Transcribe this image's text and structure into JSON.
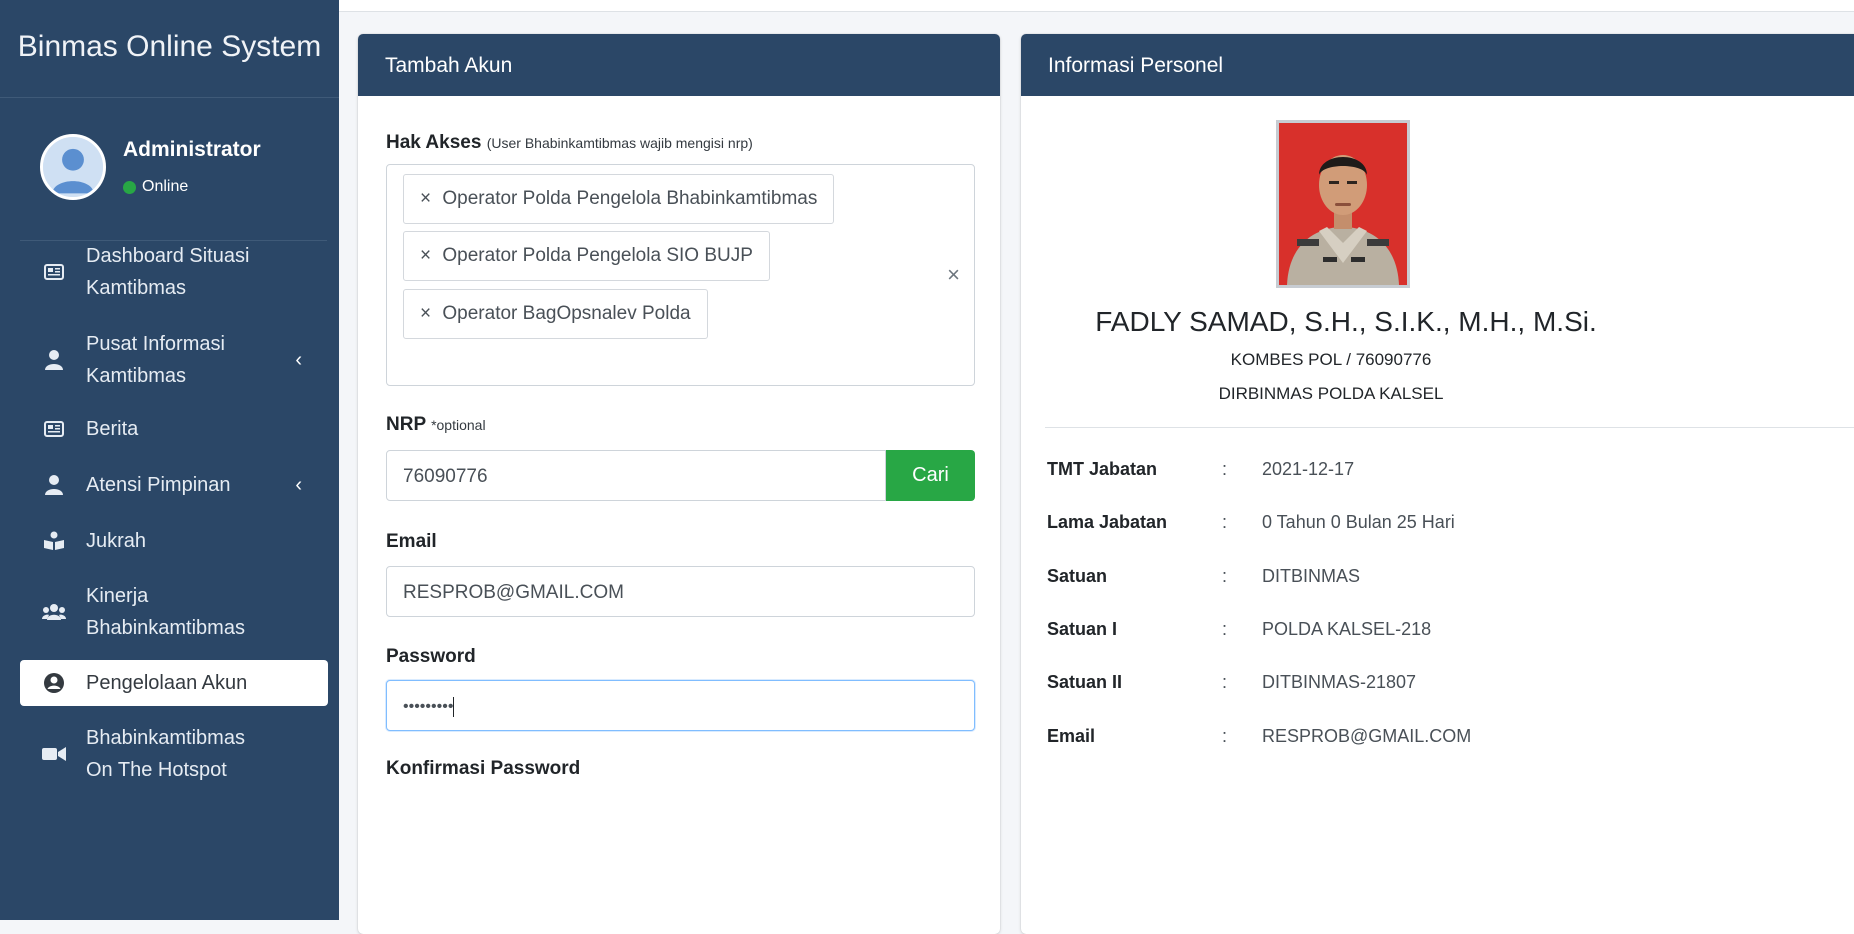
{
  "sidebar": {
    "brand": "Binmas Online System",
    "user": {
      "name": "Administrator",
      "status": "Online"
    },
    "items": [
      {
        "label_line1": "Dashboard Situasi",
        "label_line2": "Kamtibmas",
        "icon": "newspaper-icon"
      },
      {
        "label_line1": "Pusat Informasi",
        "label_line2": "Kamtibmas",
        "icon": "user-group-icon"
      },
      {
        "label": "Berita",
        "icon": "newspaper-icon"
      },
      {
        "label": "Atensi Pimpinan",
        "icon": "user-group-icon"
      },
      {
        "label": "Jukrah",
        "icon": "reader-icon"
      },
      {
        "label_line1": "Kinerja",
        "label_line2": "Bhabinkamtibmas",
        "icon": "users-icon"
      },
      {
        "label": "Pengelolaan Akun",
        "icon": "user-circle-icon"
      },
      {
        "label_line1": "Bhabinkamtibmas",
        "label_line2": "On The Hotspot",
        "icon": "video-icon"
      }
    ]
  },
  "form": {
    "title": "Tambah Akun",
    "hak_akses_label": "Hak Akses",
    "hak_akses_hint": "(User Bhabinkamtibmas wajib mengisi nrp)",
    "tags": [
      "Operator Polda Pengelola Bhabinkamtibmas",
      "Operator Polda Pengelola SIO BUJP",
      "Operator BagOpsnalev Polda"
    ],
    "tag_remove_glyph": "×",
    "clear_glyph": "×",
    "nrp_label": "NRP",
    "nrp_hint": "*optional",
    "nrp_value": "76090776",
    "cari_label": "Cari",
    "email_label": "Email",
    "email_value": "RESPROB@GMAIL.COM",
    "password_label": "Password",
    "password_value": "•••••••••",
    "konfirmasi_label": "Konfirmasi Password"
  },
  "personel": {
    "title": "Informasi Personel",
    "name": "FADLY SAMAD, S.H., S.I.K., M.H., M.Si.",
    "rank_nrp": "KOMBES POL / 76090776",
    "unit": "DIRBINMAS POLDA KALSEL",
    "separator": ":",
    "rows": [
      {
        "key": "TMT Jabatan",
        "value": "2021-12-17"
      },
      {
        "key": "Lama Jabatan",
        "value": "0 Tahun 0 Bulan 25 Hari"
      },
      {
        "key": "Satuan",
        "value": "DITBINMAS"
      },
      {
        "key": "Satuan I",
        "value": "POLDA KALSEL-218"
      },
      {
        "key": "Satuan II",
        "value": "DITBINMAS-21807"
      },
      {
        "key": "Email",
        "value": "RESPROB@GMAIL.COM"
      }
    ]
  },
  "colors": {
    "sidebar": "#2b4767",
    "card_header": "#2b4767",
    "cari_button": "#28a745",
    "online": "#28a745"
  }
}
